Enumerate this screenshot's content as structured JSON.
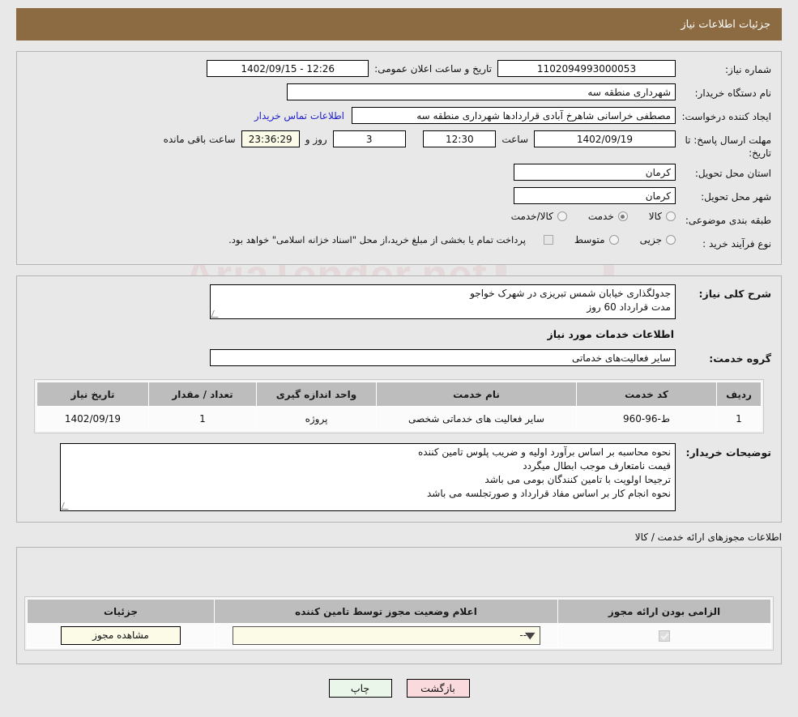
{
  "header": {
    "title": "جزئیات اطلاعات نیاز"
  },
  "form": {
    "need_number_label": "شماره نیاز:",
    "need_number_value": "1102094993000053",
    "announce_label": "تاریخ و ساعت اعلان عمومی:",
    "announce_value": "1402/09/15 - 12:26",
    "buyer_org_label": "نام دستگاه خریدار:",
    "buyer_org_value": "شهرداری منطقه سه",
    "creator_label": "ایجاد کننده درخواست:",
    "creator_value": "مصطفی خراسانی شاهرخ آبادی قراردادها شهرداری منطقه سه",
    "contact_link": "اطلاعات تماس خریدار",
    "deadline_label": "مهلت ارسال پاسخ: تا تاریخ:",
    "deadline_date": "1402/09/19",
    "hour_label": "ساعت",
    "deadline_time": "12:30",
    "days_value": "3",
    "days_label": "روز و",
    "countdown_value": "23:36:29",
    "countdown_label": "ساعت باقی مانده",
    "province_label": "استان محل تحویل:",
    "province_value": "کرمان",
    "city_label": "شهر محل تحویل:",
    "city_value": "کرمان",
    "category_label": "طبقه بندی موضوعی:",
    "category_options": [
      {
        "label": "کالا",
        "selected": false
      },
      {
        "label": "خدمت",
        "selected": true
      },
      {
        "label": "کالا/خدمت",
        "selected": false
      }
    ],
    "process_label": "نوع فرآیند خرید :",
    "process_options": [
      {
        "label": "جزیی",
        "selected": false
      },
      {
        "label": "متوسط",
        "selected": false
      }
    ],
    "treasury_note": "پرداخت تمام یا بخشی از مبلغ خرید،از محل \"اسناد خزانه اسلامی\" خواهد بود."
  },
  "summary": {
    "label": "شرح کلی نیاز:",
    "value": "جدولگذاری خیابان شمس تبریزی در شهرک خواجو\nمدت قرارداد 60 روز"
  },
  "services_section": {
    "title": "اطلاعات خدمات مورد نیاز",
    "group_label": "گروه خدمت:",
    "group_value": "سایر فعالیت‌های خدماتی",
    "columns": [
      "ردیف",
      "کد خدمت",
      "نام خدمت",
      "واحد اندازه گیری",
      "تعداد / مقدار",
      "تاریخ نیاز"
    ],
    "rows": [
      {
        "row_no": "1",
        "code": "ط-96-960",
        "name": "سایر فعالیت های خدماتی شخصی",
        "unit": "پروژه",
        "qty": "1",
        "need_date": "1402/09/19"
      }
    ]
  },
  "notes": {
    "label": "توضیحات خریدار:",
    "value": "نحوه محاسبه بر اساس برآورد اولیه و ضریب پلوس تامین کننده\nقیمت نامتعارف موجب ابطال میگردد\nترجیحا اولویت با تامین کنندگان بومی می باشد\nنحوه انجام کار بر اساس مفاد قرارداد و صورتجلسه می باشد"
  },
  "permits": {
    "caption": "اطلاعات مجوزهای ارائه خدمت / کالا",
    "columns": [
      "الزامی بودن ارائه مجوز",
      "اعلام وضعیت مجوز توسط تامین کننده",
      "جزئیات"
    ],
    "rows": [
      {
        "required": true,
        "status_value": "--",
        "details_button": "مشاهده مجوز"
      }
    ]
  },
  "footer": {
    "print_label": "چاپ",
    "back_label": "بازگشت"
  },
  "watermark": {
    "text": "AriaTender.net"
  },
  "colors": {
    "header_bg": "#8c6b42",
    "link": "#2222cc",
    "back_btn": "#fadadd",
    "print_btn": "#eaf6ea",
    "cream": "#fbfbe8"
  }
}
